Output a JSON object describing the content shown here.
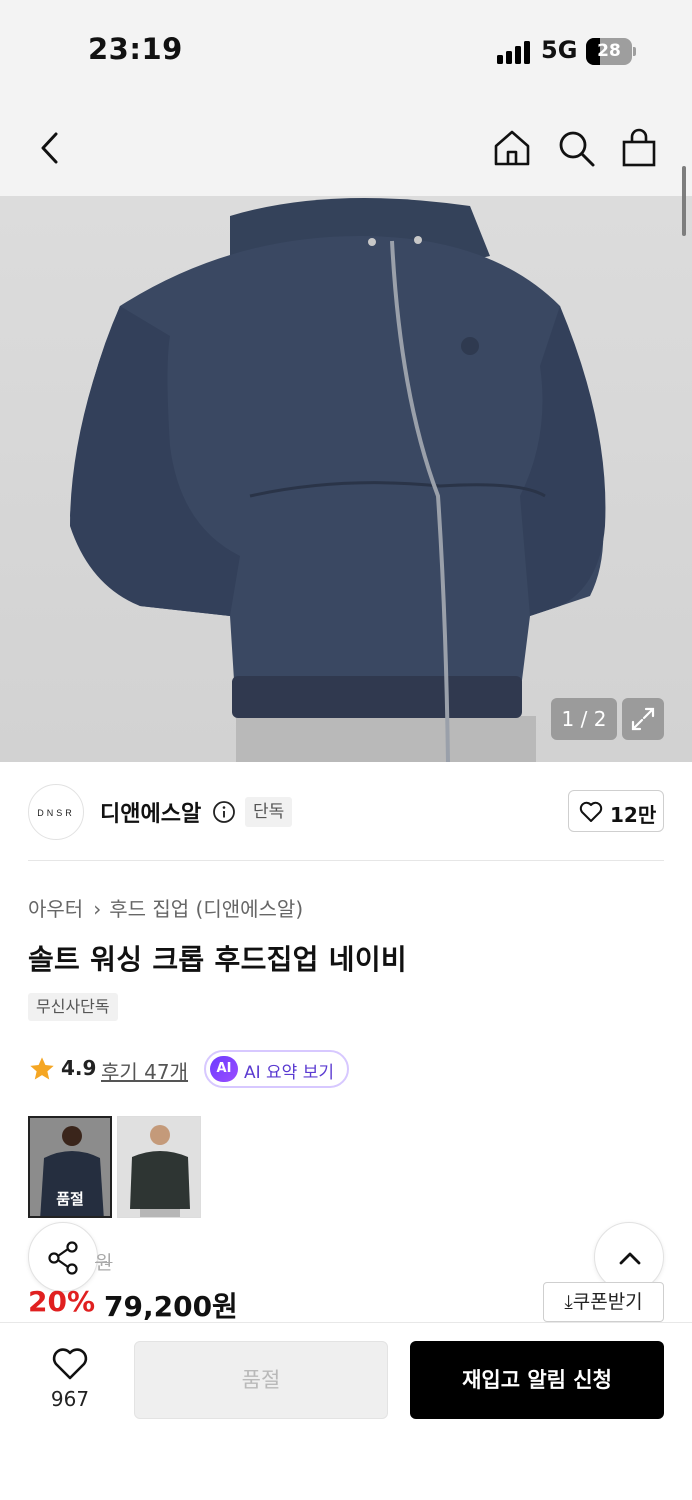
{
  "status_bar": {
    "time": "23:19",
    "network": "5G",
    "battery": "28",
    "battery_level": 0.28
  },
  "nav": {
    "back_icon": "chevron-left-icon",
    "home_icon": "home-icon",
    "search_icon": "search-icon",
    "cart_icon": "shopping-bag-icon"
  },
  "gallery": {
    "counter": "1 / 2",
    "expand_icon": "expand-icon"
  },
  "brand": {
    "logo_text": "DNSR",
    "name": "디앤에스알",
    "badge": "단독",
    "likes": "12만"
  },
  "breadcrumb": {
    "category": "아우터",
    "subcategory": "후드 집업 (디앤에스알)"
  },
  "product": {
    "title": "솔트 워싱 크롭 후드집업 네이비",
    "tag": "무신사단독",
    "rating": "4.9",
    "reviews": "후기 47개",
    "ai_badge": "AI",
    "ai_summary": "AI 요약 보기",
    "rating_color": "#f5a623"
  },
  "thumbnails": [
    {
      "label": "품절",
      "color": "navy"
    },
    {
      "label": "",
      "color": "charcoal"
    }
  ],
  "price": {
    "original_suffix": "원",
    "discount": "20%",
    "sale": "79,200원",
    "coupon": "쿠폰받기",
    "discount_color": "#e02020"
  },
  "bottom_bar": {
    "wishlist_count": "967",
    "soldout_label": "품절",
    "restock_label": "재입고 알림 신청"
  }
}
